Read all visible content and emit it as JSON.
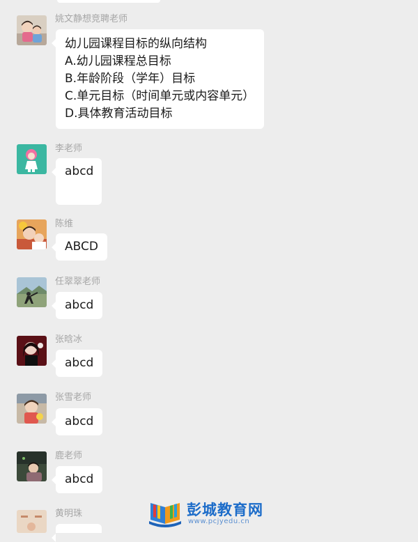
{
  "messages": [
    {
      "sender": "姚文静想竞聘老师",
      "lines": [
        "幼儿园课程目标的纵向结构",
        "A.幼儿园课程总目标",
        "B.年龄阶段（学年）目标",
        "C.单元目标（时间单元或内容单元）",
        "D.具体教育活动目标"
      ]
    },
    {
      "sender": "李老师",
      "text": "abcd"
    },
    {
      "sender": "陈维",
      "text": "ABCD"
    },
    {
      "sender": "任翠翠老师",
      "text": "abcd"
    },
    {
      "sender": "张晗冰",
      "text": "abcd"
    },
    {
      "sender": "张雪老师",
      "text": "abcd"
    },
    {
      "sender": "鹿老师",
      "text": "abcd"
    },
    {
      "sender": "黄明珠"
    }
  ],
  "watermark": {
    "title": "彭城教育网",
    "url": "www.pcjyedu.cn"
  },
  "colors": {
    "background": "#ededed",
    "bubble": "#ffffff",
    "sender_name": "#a6a6a6",
    "watermark_blue": "#1c6cc9"
  }
}
